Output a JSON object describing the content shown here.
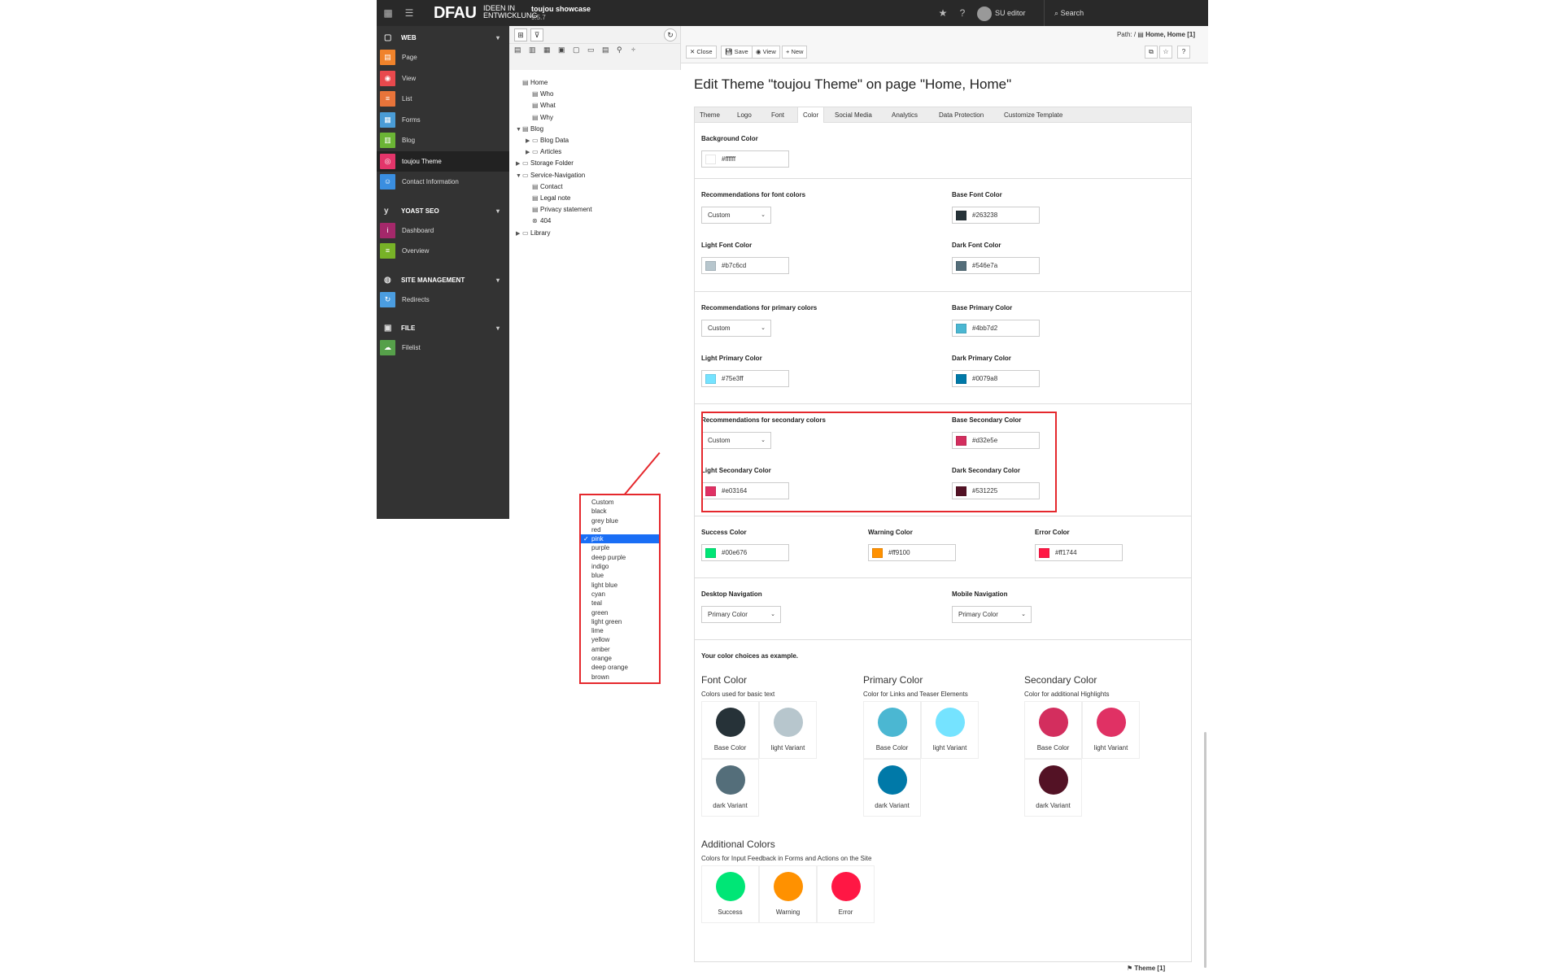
{
  "topbar": {
    "logo": "DFAU",
    "logo_sub": "IDEEN IN ENTWICKLUNG",
    "site_name": "toujou showcase",
    "site_version": "9.5.7",
    "user": "SU editor",
    "search": "Search"
  },
  "modules": {
    "groups": [
      {
        "label": "WEB",
        "items": [
          {
            "label": "Page",
            "color": "#f0832b",
            "icon": "▤"
          },
          {
            "label": "View",
            "color": "#e8494d",
            "icon": "◉"
          },
          {
            "label": "List",
            "color": "#e8743a",
            "icon": "≡"
          },
          {
            "label": "Forms",
            "color": "#4a9cd6",
            "icon": "▦"
          },
          {
            "label": "Blog",
            "color": "#6bb435",
            "icon": "▥"
          },
          {
            "label": "toujou Theme",
            "color": "#e3356a",
            "icon": "◎"
          },
          {
            "label": "Contact Information",
            "color": "#3a8ee0",
            "icon": "☺"
          }
        ]
      },
      {
        "label": "YOAST SEO",
        "items": [
          {
            "label": "Dashboard",
            "color": "#a4286a",
            "icon": "i"
          },
          {
            "label": "Overview",
            "color": "#77b227",
            "icon": "≡"
          }
        ]
      },
      {
        "label": "SITE MANAGEMENT",
        "items": [
          {
            "label": "Redirects",
            "color": "#4b9de0",
            "icon": "↻"
          }
        ]
      },
      {
        "label": "FILE",
        "items": [
          {
            "label": "Filelist",
            "color": "#56a04a",
            "icon": "☁"
          }
        ]
      }
    ]
  },
  "tree": {
    "nodes": [
      {
        "label": "Home"
      },
      {
        "label": "Who"
      },
      {
        "label": "What"
      },
      {
        "label": "Why"
      },
      {
        "label": "Blog"
      },
      {
        "label": "Blog Data"
      },
      {
        "label": "Articles"
      },
      {
        "label": "Storage Folder"
      },
      {
        "label": "Service-Navigation"
      },
      {
        "label": "Contact"
      },
      {
        "label": "Legal note"
      },
      {
        "label": "Privacy statement"
      },
      {
        "label": "404"
      },
      {
        "label": "Library"
      }
    ]
  },
  "docheader": {
    "close": "Close",
    "save": "Save",
    "view": "View",
    "new": "New",
    "path_prefix": "Path: /",
    "path_page": "Home, Home [1]"
  },
  "page_title": "Edit Theme \"toujou Theme\" on page \"Home, Home\"",
  "tabs": [
    "Theme",
    "Logo",
    "Font",
    "Color",
    "Social Media",
    "Analytics",
    "Data Protection",
    "Customize Template"
  ],
  "form": {
    "background": {
      "label": "Background Color",
      "value": "#ffffff"
    },
    "font_reco": {
      "label": "Recommendations for font colors",
      "value": "Custom"
    },
    "base_font": {
      "label": "Base Font Color",
      "value": "#263238"
    },
    "light_font": {
      "label": "Light Font Color",
      "value": "#b7c6cd"
    },
    "dark_font": {
      "label": "Dark Font Color",
      "value": "#546e7a"
    },
    "primary_reco": {
      "label": "Recommendations for primary colors",
      "value": "Custom"
    },
    "base_primary": {
      "label": "Base Primary Color",
      "value": "#4bb7d2"
    },
    "light_primary": {
      "label": "Light Primary Color",
      "value": "#75e3ff"
    },
    "dark_primary": {
      "label": "Dark Primary Color",
      "value": "#0079a8"
    },
    "secondary_reco": {
      "label": "Recommendations for secondary colors",
      "value": "Custom"
    },
    "base_secondary": {
      "label": "Base Secondary Color",
      "value": "#d32e5e"
    },
    "light_secondary": {
      "label": "Light Secondary Color",
      "value": "#e03164"
    },
    "dark_secondary": {
      "label": "Dark Secondary Color",
      "value": "#531225"
    },
    "success": {
      "label": "Success Color",
      "value": "#00e676"
    },
    "warning": {
      "label": "Warning Color",
      "value": "#ff9100"
    },
    "error": {
      "label": "Error Color",
      "value": "#ff1744"
    },
    "desktop_nav": {
      "label": "Desktop Navigation",
      "value": "Primary Color"
    },
    "mobile_nav": {
      "label": "Mobile Navigation",
      "value": "Primary Color"
    }
  },
  "preview": {
    "intro": "Your color choices as example.",
    "font": {
      "title": "Font Color",
      "sub": "Colors used for basic text",
      "base": "Base Color",
      "light": "light Variant",
      "dark": "dark Variant"
    },
    "primary": {
      "title": "Primary Color",
      "sub": "Color for Links and Teaser Elements",
      "base": "Base Color",
      "light": "light Variant",
      "dark": "dark Variant"
    },
    "secondary": {
      "title": "Secondary Color",
      "sub": "Color for additional Highlights",
      "base": "Base Color",
      "light": "light Variant",
      "dark": "dark Variant"
    },
    "additional": {
      "title": "Additional Colors",
      "sub": "Colors for Input Feedback in Forms and Actions on the Site",
      "success": "Success",
      "warning": "Warning",
      "error": "Error"
    }
  },
  "footer": {
    "record": "Theme [1]"
  },
  "dropdown": {
    "options": [
      "Custom",
      "black",
      "grey blue",
      "red",
      "pink",
      "purple",
      "deep purple",
      "indigo",
      "blue",
      "light blue",
      "cyan",
      "teal",
      "green",
      "light green",
      "lime",
      "yellow",
      "amber",
      "orange",
      "deep orange",
      "brown"
    ],
    "selected": "pink",
    "check": "✓"
  }
}
